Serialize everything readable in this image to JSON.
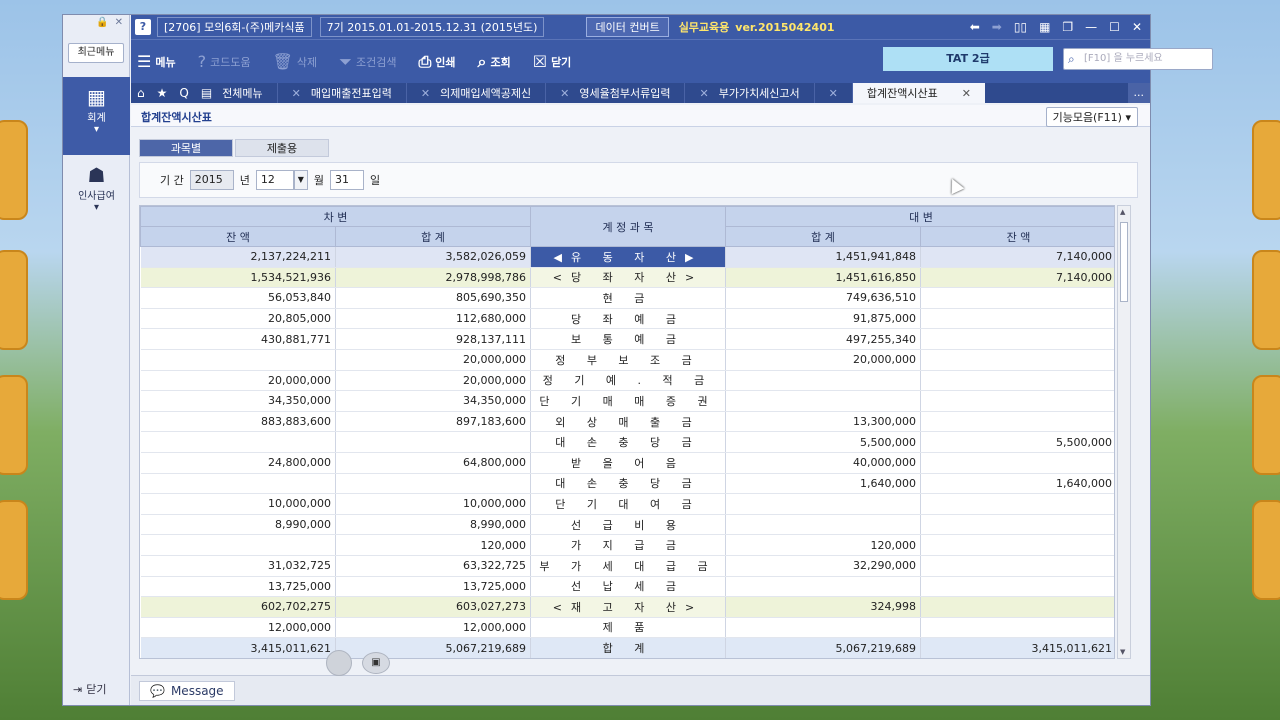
{
  "rail": {
    "recent": "최근메뉴",
    "items": [
      "회계",
      "인사급여"
    ],
    "close": "닫기"
  },
  "titlebar": {
    "company": "[2706] 모의6회-(주)메카식품",
    "period": "7기 2015.01.01-2015.12.31 (2015년도)",
    "data_button": "데이터 컨버트",
    "label": "실무교육용",
    "version": "ver.2015042401"
  },
  "toolbar": {
    "menu": "메뉴",
    "help": "코드도움",
    "delete": "삭제",
    "filter": "조건검색",
    "print": "인쇄",
    "lookup": "조회",
    "close": "닫기",
    "tat": "TAT 2급",
    "search_placeholder": "[F10] 을 누르세요"
  },
  "tabs": {
    "all": "전체메뉴",
    "items": [
      "매입매출전표입력",
      "의제매입세액공제신",
      "영세율첨부서류입력",
      "부가가치세신고서",
      "합계잔액시산표"
    ],
    "more": "..."
  },
  "page": {
    "title": "합계잔액시산표",
    "func": "기능모음(F11)",
    "subtabs": [
      "과목별",
      "제출용"
    ]
  },
  "filter": {
    "label": "기 간",
    "year": "2015",
    "year_unit": "년",
    "month": "12",
    "month_unit": "월",
    "day": "31",
    "day_unit": "일"
  },
  "table": {
    "debit": "차 변",
    "credit": "대 변",
    "account": "계 정 과 목",
    "balance": "잔 액",
    "total": "합 계",
    "rows": [
      [
        "2,137,224,211",
        "3,582,026,059",
        "◀유 동 자 산▶",
        "1,451,941,848",
        "7,140,000"
      ],
      [
        "1,534,521,936",
        "2,978,998,786",
        "<당 좌 자 산>",
        "1,451,616,850",
        "7,140,000"
      ],
      [
        "56,053,840",
        "805,690,350",
        "현 금",
        "749,636,510",
        ""
      ],
      [
        "20,805,000",
        "112,680,000",
        "당 좌 예 금",
        "91,875,000",
        ""
      ],
      [
        "430,881,771",
        "928,137,111",
        "보 통 예 금",
        "497,255,340",
        ""
      ],
      [
        "",
        "20,000,000",
        "정 부 보 조 금",
        "20,000,000",
        ""
      ],
      [
        "20,000,000",
        "20,000,000",
        "정 기 예 . 적 금",
        "",
        ""
      ],
      [
        "34,350,000",
        "34,350,000",
        "단 기 매 매 증 권",
        "",
        ""
      ],
      [
        "883,883,600",
        "897,183,600",
        "외 상 매 출 금",
        "13,300,000",
        ""
      ],
      [
        "",
        "",
        "대 손 충 당 금",
        "5,500,000",
        "5,500,000"
      ],
      [
        "24,800,000",
        "64,800,000",
        "받 을 어 음",
        "40,000,000",
        ""
      ],
      [
        "",
        "",
        "대 손 충 당 금",
        "1,640,000",
        "1,640,000"
      ],
      [
        "10,000,000",
        "10,000,000",
        "단 기 대 여 금",
        "",
        ""
      ],
      [
        "8,990,000",
        "8,990,000",
        "선 급 비 용",
        "",
        ""
      ],
      [
        "",
        "120,000",
        "가 지 급 금",
        "120,000",
        ""
      ],
      [
        "31,032,725",
        "63,322,725",
        "부 가 세 대 급 금",
        "32,290,000",
        ""
      ],
      [
        "13,725,000",
        "13,725,000",
        "선 납 세 금",
        "",
        ""
      ],
      [
        "602,702,275",
        "603,027,273",
        "<재 고 자 산>",
        "324,998",
        ""
      ],
      [
        "12,000,000",
        "12,000,000",
        "제 품",
        "",
        ""
      ]
    ],
    "total_row": [
      "3,415,011,621",
      "5,067,219,689",
      "합 계",
      "5,067,219,689",
      "3,415,011,621"
    ]
  },
  "status": {
    "message": "Message"
  }
}
